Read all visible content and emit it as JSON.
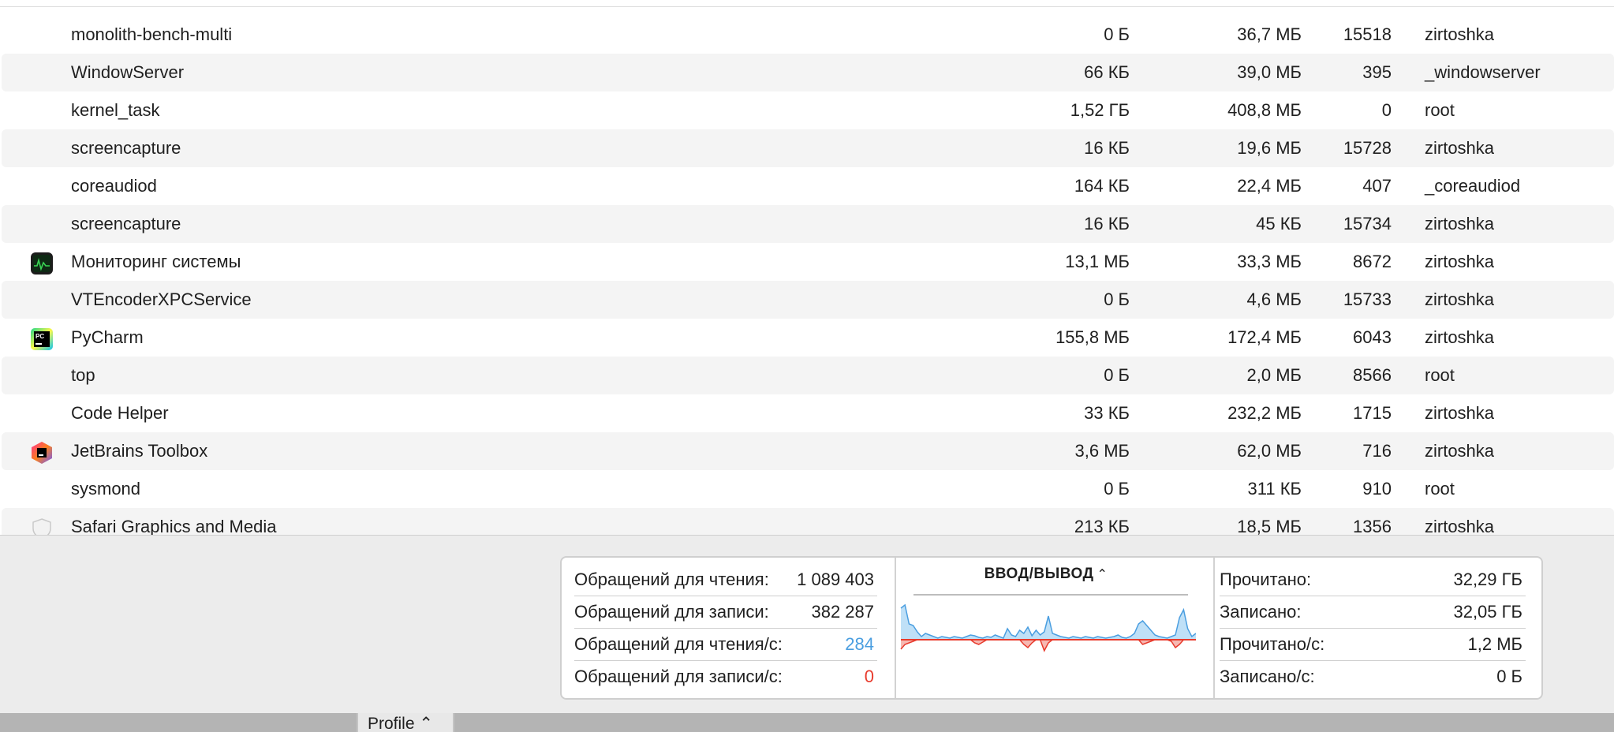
{
  "processes": [
    {
      "name": "monolith-bench-multi",
      "written": "0 Б",
      "read": "36,7 МБ",
      "pid": "15518",
      "user": "zirtoshka",
      "icon": ""
    },
    {
      "name": "WindowServer",
      "written": "66 КБ",
      "read": "39,0 МБ",
      "pid": "395",
      "user": "_windowserver",
      "icon": ""
    },
    {
      "name": "kernel_task",
      "written": "1,52 ГБ",
      "read": "408,8 МБ",
      "pid": "0",
      "user": "root",
      "icon": ""
    },
    {
      "name": "screencapture",
      "written": "16 КБ",
      "read": "19,6 МБ",
      "pid": "15728",
      "user": "zirtoshka",
      "icon": ""
    },
    {
      "name": "coreaudiod",
      "written": "164 КБ",
      "read": "22,4 МБ",
      "pid": "407",
      "user": "_coreaudiod",
      "icon": ""
    },
    {
      "name": "screencapture",
      "written": "16 КБ",
      "read": "45 КБ",
      "pid": "15734",
      "user": "zirtoshka",
      "icon": ""
    },
    {
      "name": "Мониторинг системы",
      "written": "13,1 МБ",
      "read": "33,3 МБ",
      "pid": "8672",
      "user": "zirtoshka",
      "icon": "activity-monitor-icon"
    },
    {
      "name": "VTEncoderXPCService",
      "written": "0 Б",
      "read": "4,6 МБ",
      "pid": "15733",
      "user": "zirtoshka",
      "icon": ""
    },
    {
      "name": "PyCharm",
      "written": "155,8 МБ",
      "read": "172,4 МБ",
      "pid": "6043",
      "user": "zirtoshka",
      "icon": "pycharm-icon"
    },
    {
      "name": "top",
      "written": "0 Б",
      "read": "2,0 МБ",
      "pid": "8566",
      "user": "root",
      "icon": ""
    },
    {
      "name": "Code Helper",
      "written": "33 КБ",
      "read": "232,2 МБ",
      "pid": "1715",
      "user": "zirtoshka",
      "icon": ""
    },
    {
      "name": "JetBrains Toolbox",
      "written": "3,6 МБ",
      "read": "62,0 МБ",
      "pid": "716",
      "user": "zirtoshka",
      "icon": "jetbrains-toolbox-icon"
    },
    {
      "name": "sysmond",
      "written": "0 Б",
      "read": "311 КБ",
      "pid": "910",
      "user": "root",
      "icon": ""
    },
    {
      "name": "Safari Graphics and Media",
      "written": "213 КБ",
      "read": "18,5 МБ",
      "pid": "1356",
      "user": "zirtoshka",
      "icon": "safari-shield-icon"
    }
  ],
  "stats_left": [
    {
      "label": "Обращений для чтения:",
      "value": "1 089 403"
    },
    {
      "label": "Обращений для записи:",
      "value": "382 287"
    },
    {
      "label": "Обращений для чтения/с:",
      "value": "284"
    },
    {
      "label": "Обращений для записи/с:",
      "value": "0"
    }
  ],
  "graph": {
    "title": "ВВОД/ВЫВОД",
    "read_color": "#4a9ee0",
    "write_color": "#e83a2c",
    "read_series": [
      40,
      44,
      20,
      18,
      10,
      4,
      8,
      6,
      4,
      2,
      4,
      3,
      2,
      4,
      3,
      2,
      4,
      6,
      5,
      3,
      2,
      4,
      3,
      6,
      4,
      2,
      14,
      6,
      4,
      12,
      8,
      16,
      5,
      12,
      6,
      10,
      30,
      8,
      6,
      4,
      3,
      2,
      4,
      3,
      2,
      4,
      3,
      2,
      4,
      3,
      2,
      3,
      4,
      6,
      3,
      2,
      4,
      8,
      20,
      24,
      18,
      12,
      6,
      4,
      3,
      2,
      4,
      6,
      28,
      38,
      14,
      4,
      8
    ],
    "write_series": [
      12,
      6,
      4,
      2,
      0,
      0,
      0,
      0,
      0,
      0,
      0,
      0,
      0,
      0,
      0,
      0,
      0,
      0,
      4,
      6,
      3,
      0,
      0,
      0,
      0,
      0,
      0,
      0,
      0,
      0,
      6,
      10,
      4,
      0,
      0,
      14,
      4,
      0,
      0,
      0,
      0,
      0,
      0,
      0,
      0,
      0,
      0,
      0,
      0,
      0,
      0,
      0,
      0,
      0,
      0,
      0,
      0,
      0,
      0,
      6,
      4,
      2,
      0,
      0,
      0,
      0,
      2,
      10,
      6,
      0,
      0,
      0,
      0
    ]
  },
  "stats_right": [
    {
      "label": "Прочитано:",
      "value": "32,29 ГБ"
    },
    {
      "label": "Записано:",
      "value": "32,05 ГБ"
    },
    {
      "label": "Прочитано/с:",
      "value": "1,2 МБ"
    },
    {
      "label": "Записано/с:",
      "value": "0 Б"
    }
  ],
  "profile_button": "Profile ⌃"
}
